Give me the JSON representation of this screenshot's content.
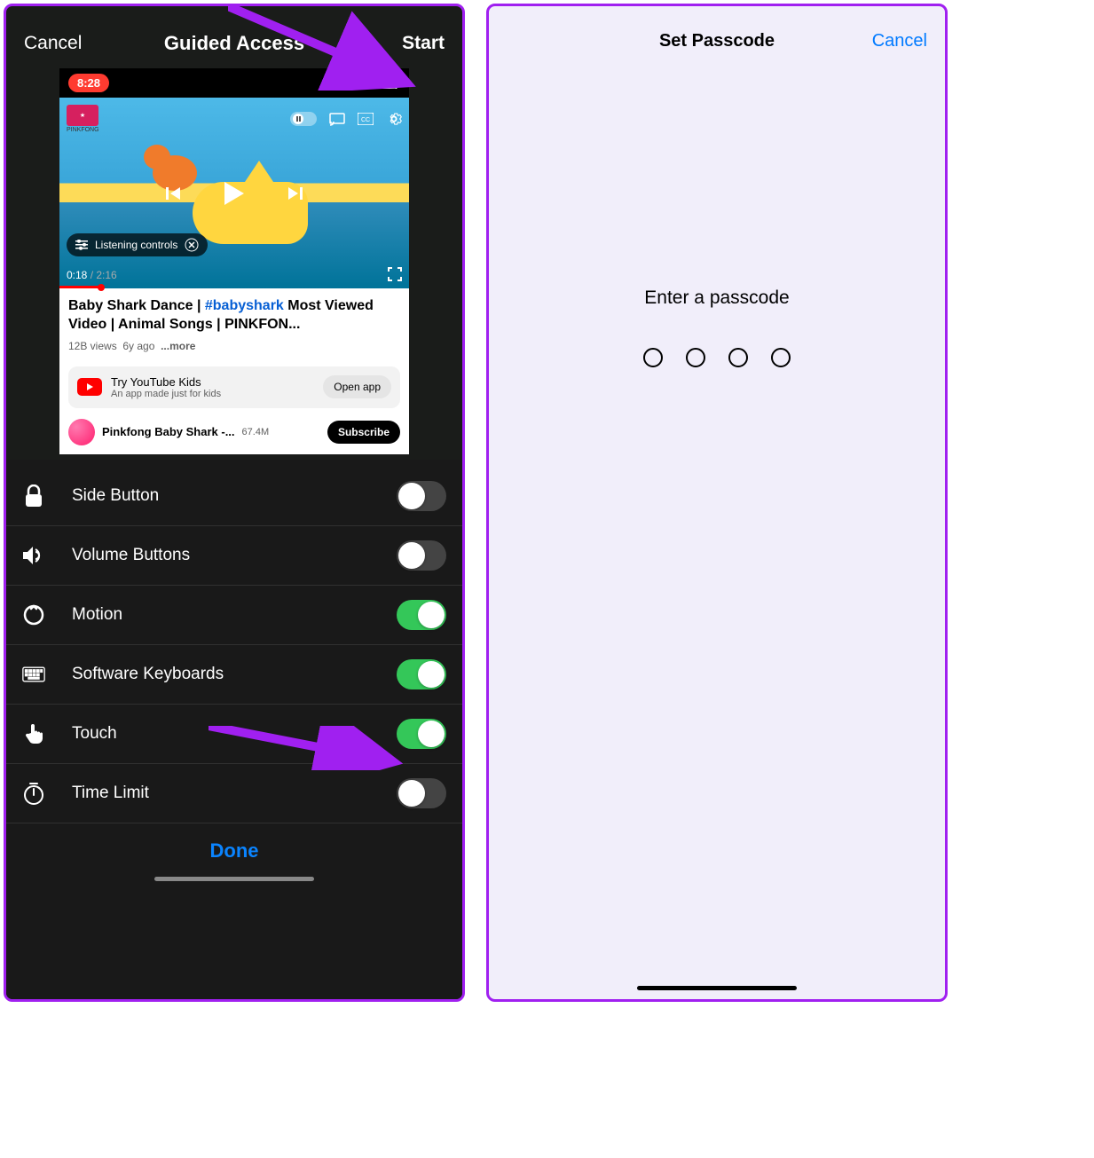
{
  "left": {
    "header": {
      "cancel": "Cancel",
      "title": "Guided Access",
      "start": "Start"
    },
    "youtube": {
      "status_time": "8:28",
      "listening_pill": "Listening controls",
      "progress_current": "0:18",
      "progress_total": "2:16",
      "title_pre": "Baby Shark Dance | ",
      "title_tag": "#babyshark",
      "title_post": " Most Viewed Video | Animal Songs | PINKFON...",
      "views": "12B views",
      "age": "6y ago",
      "more": "...more",
      "kids_title": "Try YouTube Kids",
      "kids_sub": "An app made just for kids",
      "open_app": "Open app",
      "channel": "Pinkfong Baby Shark -...",
      "subs": "67.4M",
      "subscribe": "Subscribe"
    },
    "options": [
      {
        "icon": "lock",
        "label": "Side Button",
        "on": false
      },
      {
        "icon": "volume",
        "label": "Volume Buttons",
        "on": false
      },
      {
        "icon": "motion",
        "label": "Motion",
        "on": true
      },
      {
        "icon": "keyboard",
        "label": "Software Keyboards",
        "on": true
      },
      {
        "icon": "touch",
        "label": "Touch",
        "on": true
      },
      {
        "icon": "timer",
        "label": "Time Limit",
        "on": false
      }
    ],
    "done": "Done"
  },
  "right": {
    "title": "Set Passcode",
    "cancel": "Cancel",
    "prompt": "Enter a passcode"
  }
}
